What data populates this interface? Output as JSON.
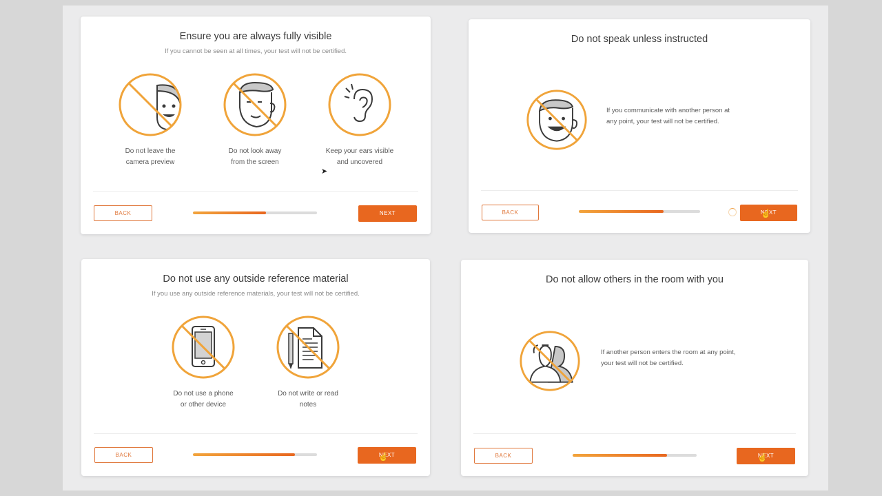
{
  "accent": "#e8671f",
  "ring_color": "#f0a43a",
  "cards": [
    {
      "title": "Ensure you are always fully visible",
      "subtitle": "If you cannot be seen at all times, your test will not be certified.",
      "items": [
        {
          "icon": "leave-camera-icon",
          "line1": "Do not leave the",
          "line2": "camera preview"
        },
        {
          "icon": "look-away-icon",
          "line1": "Do not look away",
          "line2": "from the screen"
        },
        {
          "icon": "ear-icon",
          "line1": "Keep your ears visible",
          "line2": "and uncovered"
        }
      ],
      "back_label": "BACK",
      "next_label": "NEXT",
      "progress": 0.59
    },
    {
      "title": "Do not speak unless instructed",
      "icon": "no-speaking-icon",
      "line1": "If you communicate with another person at",
      "line2": "any point, your test will not be certified.",
      "back_label": "BACK",
      "next_label": "NEXT",
      "progress": 0.7
    },
    {
      "title": "Do not use any outside reference material",
      "subtitle": "If you use any outside reference materials, your test will not be certified.",
      "items": [
        {
          "icon": "no-phone-icon",
          "line1": "Do not use a phone",
          "line2": "or other device"
        },
        {
          "icon": "no-notes-icon",
          "line1": "Do not write or read",
          "line2": "notes"
        }
      ],
      "back_label": "BACK",
      "next_label": "NEXT",
      "progress": 0.82
    },
    {
      "title": "Do not allow others in the room with you",
      "icon": "no-others-icon",
      "line1": "If another person enters the room at any point,",
      "line2": "your test will not be certified.",
      "back_label": "BACK",
      "next_label": "NEXT",
      "progress": 0.76
    }
  ]
}
